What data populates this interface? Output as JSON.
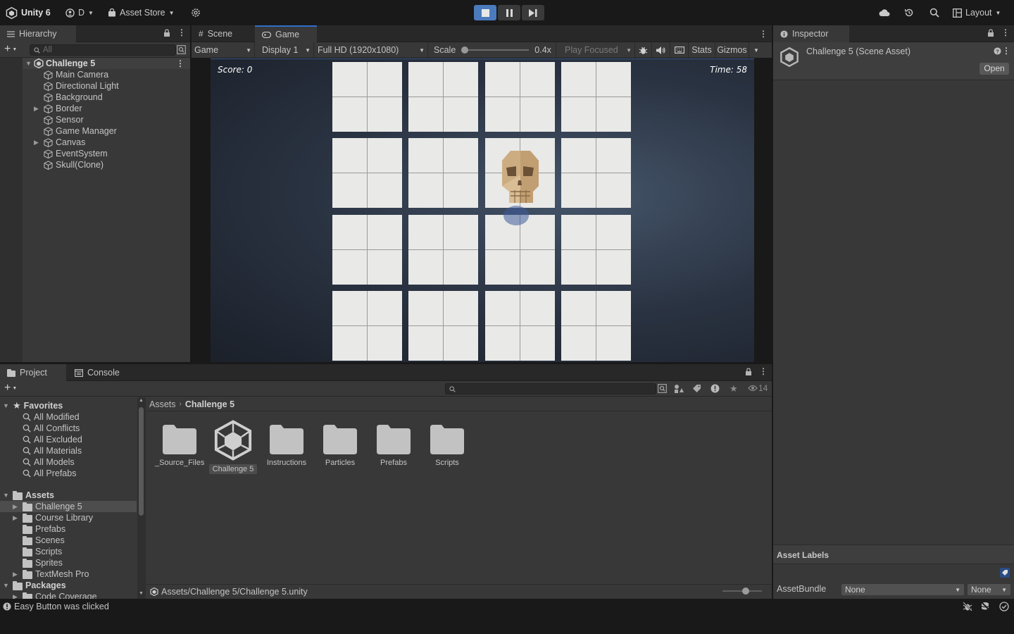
{
  "toolbar": {
    "app_title": "Unity 6",
    "account": "D",
    "asset_store": "Asset Store",
    "layout": "Layout"
  },
  "hierarchy": {
    "tab": "Hierarchy",
    "search_placeholder": "All",
    "scene": "Challenge 5",
    "items": [
      {
        "label": "Main Camera",
        "foldout": false
      },
      {
        "label": "Directional Light",
        "foldout": false
      },
      {
        "label": "Background",
        "foldout": false
      },
      {
        "label": "Border",
        "foldout": true
      },
      {
        "label": "Sensor",
        "foldout": false
      },
      {
        "label": "Game Manager",
        "foldout": false
      },
      {
        "label": "Canvas",
        "foldout": true
      },
      {
        "label": "EventSystem",
        "foldout": false
      },
      {
        "label": "Skull(Clone)",
        "foldout": false
      }
    ]
  },
  "game_view": {
    "tabs": {
      "scene": "Scene",
      "game": "Game"
    },
    "view_mode": "Game",
    "display": "Display 1",
    "resolution": "Full HD (1920x1080)",
    "scale_label": "Scale",
    "scale_value": "0.4x",
    "play_focused": "Play Focused",
    "stats": "Stats",
    "gizmos": "Gizmos",
    "score_text": "Score: 0",
    "time_text": "Time: 58",
    "grid_rows": 4,
    "grid_cols": 4,
    "skull_cell": [
      1,
      2
    ]
  },
  "inspector": {
    "tab": "Inspector",
    "title": "Challenge 5 (Scene Asset)",
    "open_button": "Open",
    "asset_labels": "Asset Labels",
    "asset_bundle_label": "AssetBundle",
    "asset_bundle_value": "None",
    "asset_bundle_variant": "None"
  },
  "project": {
    "tabs": {
      "project": "Project",
      "console": "Console"
    },
    "hidden_count": "14",
    "favorites_header": "Favorites",
    "favorites": [
      "All Modified",
      "All Conflicts",
      "All Excluded",
      "All Materials",
      "All Models",
      "All Prefabs"
    ],
    "assets_header": "Assets",
    "asset_folders": [
      {
        "label": "Challenge 5",
        "foldout": true,
        "selected": true
      },
      {
        "label": "Course Library",
        "foldout": true,
        "selected": false
      },
      {
        "label": "Prefabs",
        "foldout": false,
        "selected": false
      },
      {
        "label": "Scenes",
        "foldout": false,
        "selected": false
      },
      {
        "label": "Scripts",
        "foldout": false,
        "selected": false
      },
      {
        "label": "Sprites",
        "foldout": false,
        "selected": false
      },
      {
        "label": "TextMesh Pro",
        "foldout": true,
        "selected": false
      }
    ],
    "packages_header": "Packages",
    "package_folders": [
      "Code Coverage"
    ],
    "breadcrumb": {
      "root": "Assets",
      "current": "Challenge 5"
    },
    "grid_items": [
      {
        "label": "_Source_Files",
        "kind": "folder"
      },
      {
        "label": "Challenge 5",
        "kind": "scene"
      },
      {
        "label": "Instructions",
        "kind": "folder"
      },
      {
        "label": "Particles",
        "kind": "folder"
      },
      {
        "label": "Prefabs",
        "kind": "folder"
      },
      {
        "label": "Scripts",
        "kind": "folder"
      }
    ],
    "footer_path": "Assets/Challenge 5/Challenge 5.unity"
  },
  "status": {
    "message": "Easy Button was clicked"
  },
  "colors": {
    "accent": "#2f6ec9",
    "play_active": "#4b7bbd",
    "panel": "#383838",
    "tile": "#e9e9e7"
  }
}
